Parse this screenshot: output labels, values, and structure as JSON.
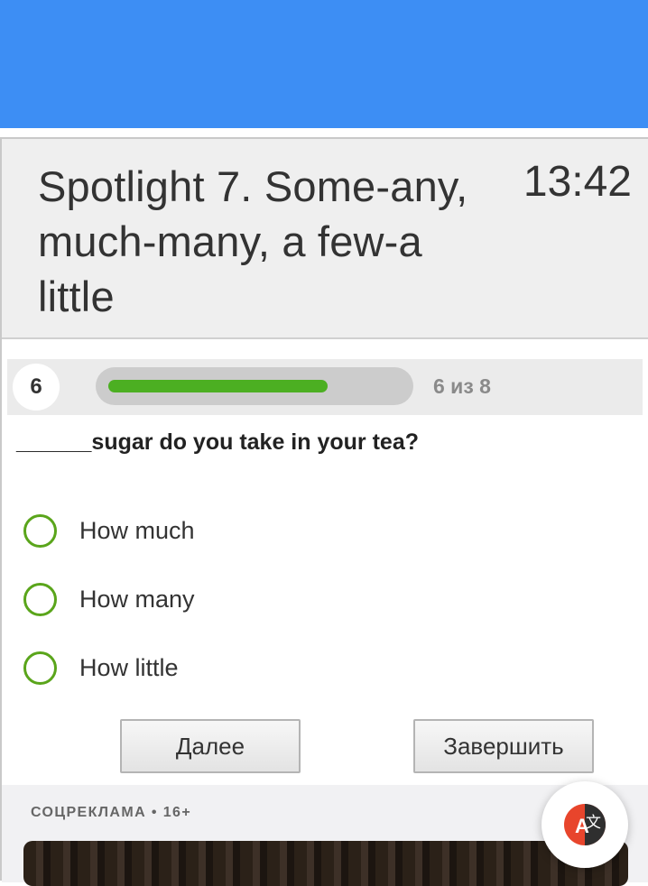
{
  "header": {
    "title": "Spotlight 7. Some-any, much-many, a few-a little",
    "timer": "13:42"
  },
  "progress": {
    "question_number": "6",
    "count_text": "6 из 8",
    "fraction": 0.75
  },
  "question": {
    "text": "______sugar do you take in your tea?"
  },
  "answers": [
    {
      "label": "How much"
    },
    {
      "label": "How many"
    },
    {
      "label": "How little"
    }
  ],
  "buttons": {
    "next_label": "Далее",
    "finish_label": "Завершить"
  },
  "ad": {
    "label": "СОЦРЕКЛАМА • 16+"
  },
  "colors": {
    "topbar": "#3d8ef4",
    "progress_fill": "#4caf22",
    "radio": "#5aa51b"
  },
  "icons": {
    "translate": "translate-icon"
  }
}
